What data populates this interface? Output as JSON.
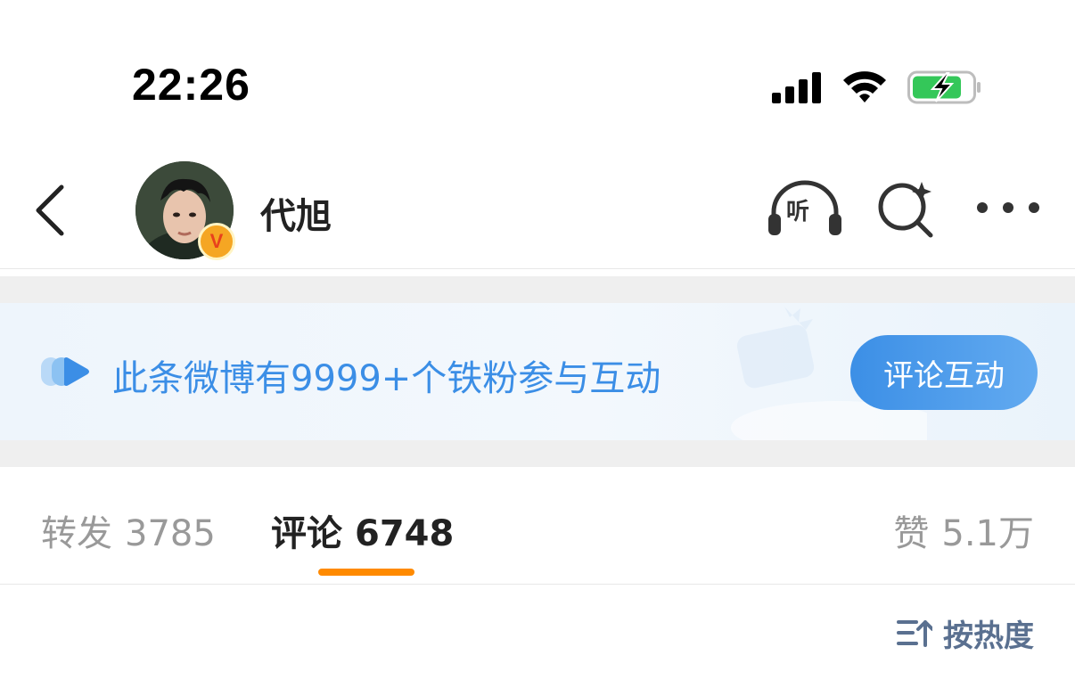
{
  "status_bar": {
    "time": "22:26"
  },
  "header": {
    "username": "代旭",
    "verified_badge": "V",
    "listen_label": "听"
  },
  "banner": {
    "text": "此条微博有9999+个铁粉参与互动",
    "button_label": "评论互动"
  },
  "tabs": {
    "reposts": {
      "label": "转发",
      "count": "3785"
    },
    "comments": {
      "label": "评论",
      "count": "6748"
    },
    "likes": {
      "label": "赞",
      "count": "5.1万"
    }
  },
  "sort": {
    "label": "按热度"
  },
  "colors": {
    "accent_orange": "#ff8a00",
    "link_blue": "#3b8ee6",
    "verified_gold": "#f5a623"
  }
}
